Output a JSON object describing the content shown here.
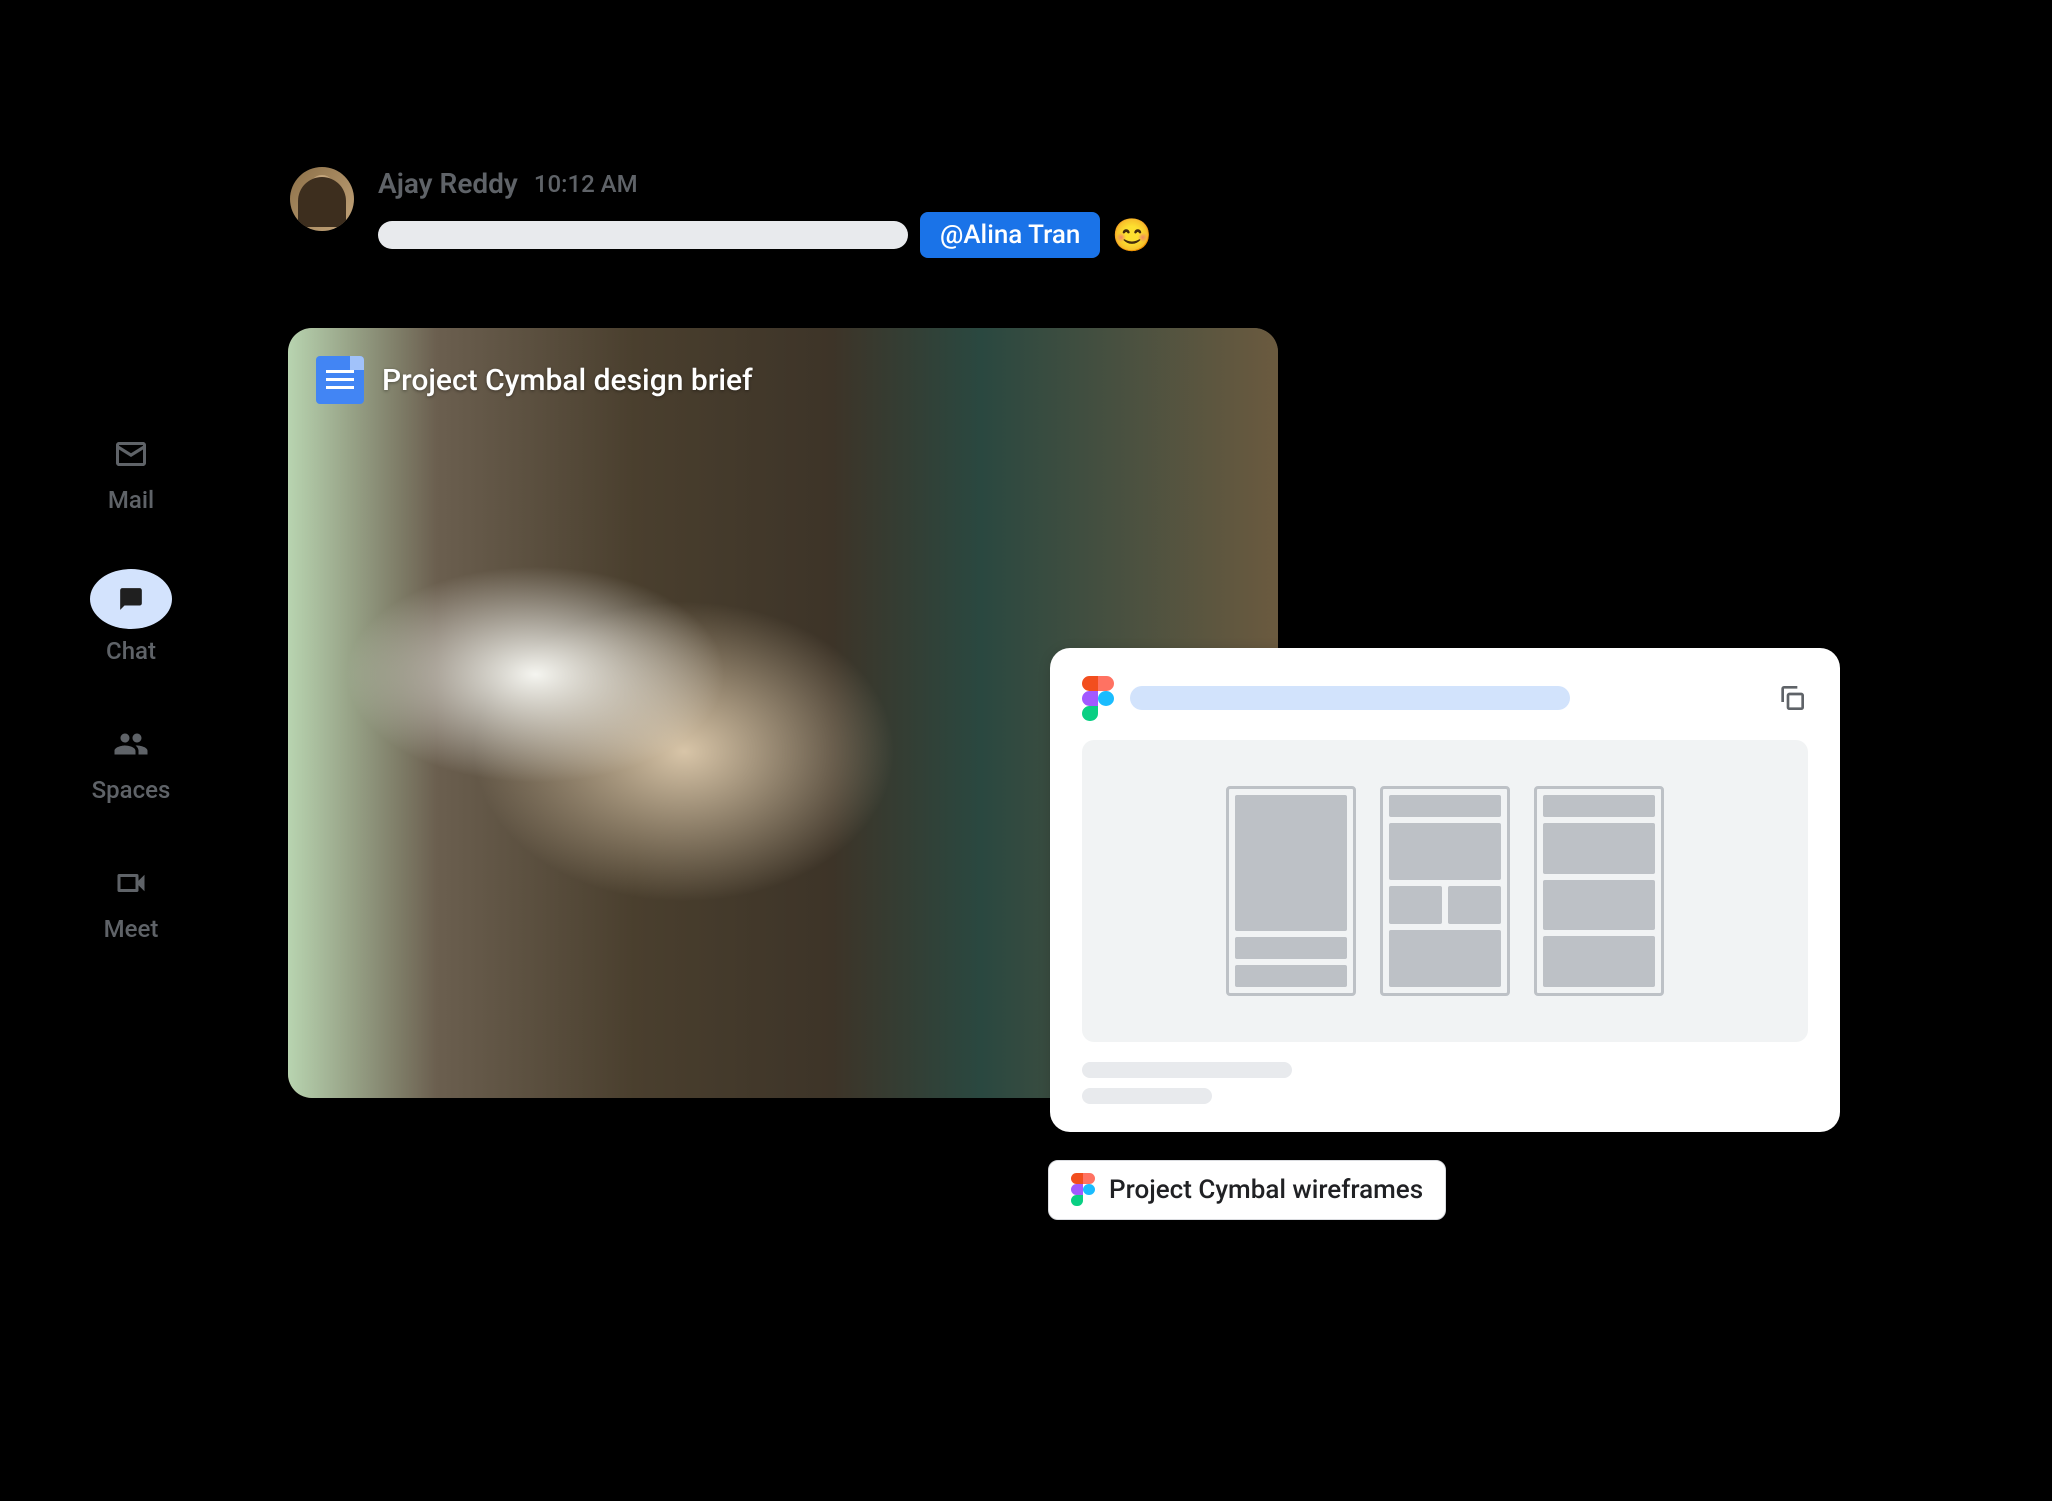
{
  "sidebar": {
    "items": [
      {
        "label": "Mail",
        "icon": "mail-icon",
        "active": false
      },
      {
        "label": "Chat",
        "icon": "chat-icon",
        "active": true
      },
      {
        "label": "Spaces",
        "icon": "spaces-icon",
        "active": false
      },
      {
        "label": "Meet",
        "icon": "meet-icon",
        "active": false
      }
    ]
  },
  "message": {
    "sender_name": "Ajay Reddy",
    "timestamp": "10:12 AM",
    "mention": "@Alina Tran",
    "emoji": "😊"
  },
  "doc_attachment": {
    "title": "Project Cymbal design brief",
    "app": "google-docs"
  },
  "figma_chip": {
    "label": "Project Cymbal wireframes"
  }
}
